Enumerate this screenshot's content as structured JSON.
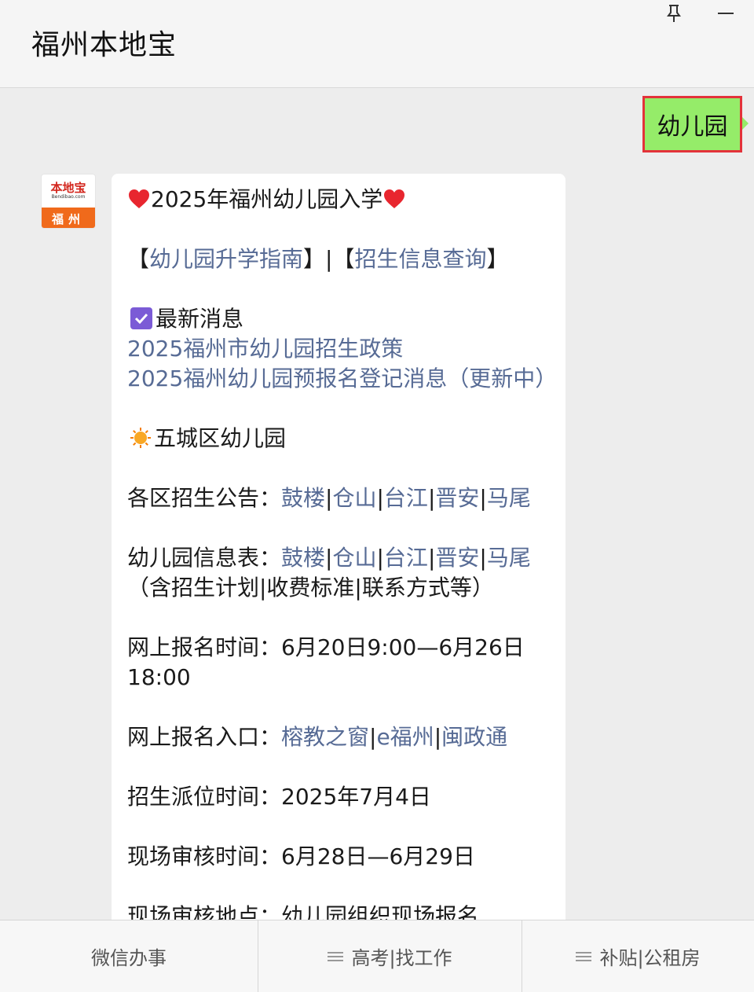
{
  "header": {
    "title": "福州本地宝"
  },
  "user_message": {
    "text": "幼儿园"
  },
  "avatar": {
    "top_text": "本地宝",
    "domain_text": "Bendibao.com",
    "city_text": "福州"
  },
  "bot_message": {
    "title": "2025年福州幼儿园入学",
    "guide_open": "【",
    "guide_link": "幼儿园升学指南",
    "guide_mid": "】|【",
    "query_link": "招生信息查询",
    "query_close": "】",
    "news_heading": "最新消息",
    "news_links": [
      "2025福州市幼儿园招生政策",
      "2025福州幼儿园预报名登记消息（更新中）"
    ],
    "district_heading": "五城区幼儿园",
    "notice_label": "各区招生公告：",
    "info_label": "幼儿园信息表：",
    "districts": [
      "鼓楼",
      "仓山",
      "台江",
      "晋安",
      "马尾"
    ],
    "separator": "|",
    "info_note": "（含招生计划|收费标准|联系方式等）",
    "signup_time_label": "网上报名时间：",
    "signup_time_value_1": "6月20日9:00—6月26日",
    "signup_time_value_2": "18:00",
    "entry_label": "网上报名入口：",
    "entry_links": [
      "榕教之窗",
      "e福州",
      "闽政通"
    ],
    "dispatch_label": "招生派位时间：",
    "dispatch_value": "2025年7月4日",
    "review_time_label": "现场审核时间：",
    "review_time_value": "6月28日—6月29日",
    "review_place_label": "现场审核地点：",
    "review_place_value": "幼儿园组织现场报名"
  },
  "menu": {
    "items": [
      "微信办事",
      "高考|找工作",
      "补贴|公租房"
    ]
  },
  "colors": {
    "link": "#576b95",
    "user_bubble": "#95ec69",
    "highlight_border": "#e3323a",
    "chat_bg": "#ededed"
  }
}
